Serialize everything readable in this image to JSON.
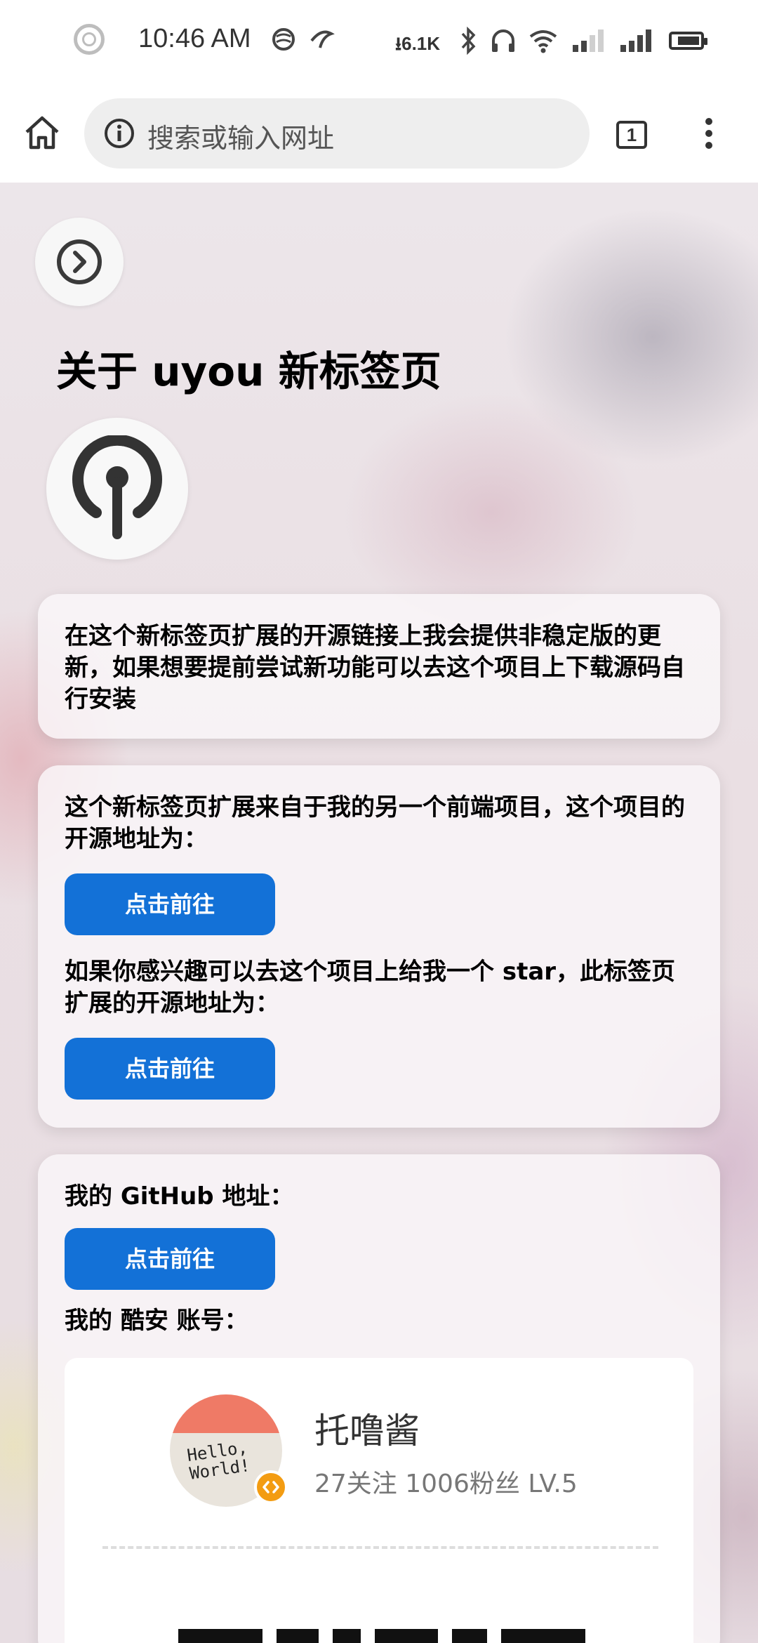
{
  "status_bar": {
    "time": "10:46 AM",
    "net_speed": "6.1K"
  },
  "browser": {
    "url_placeholder": "搜索或输入网址",
    "tab_count": "1"
  },
  "page": {
    "title": "关于 uyou 新标签页",
    "card1": {
      "text": "在这个新标签页扩展的开源链接上我会提供非稳定版的更新，如果想要提前尝试新功能可以去这个项目上下载源码自行安装"
    },
    "card2": {
      "text1": "这个新标签页扩展来自于我的另一个前端项目，这个项目的开源地址为：",
      "button1": "点击前往",
      "text2": "如果你感兴趣可以去这个项目上给我一个 star，此标签页扩展的开源地址为：",
      "button2": "点击前往"
    },
    "card3": {
      "github_label": "我的 GitHub 地址：",
      "button": "点击前往",
      "coolapk_label": "我的 酷安 账号：",
      "profile": {
        "avatar_text": "Hello,\nWorld!",
        "name": "托噜酱",
        "stats": "27关注 1006粉丝 LV.5"
      }
    }
  }
}
